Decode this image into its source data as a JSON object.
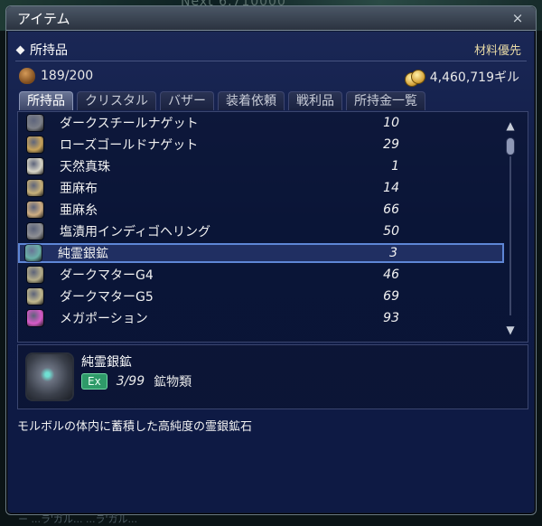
{
  "background": {
    "ghost_text": "Next 6,710000"
  },
  "window": {
    "title": "アイテム",
    "close_icon": "×"
  },
  "header": {
    "section_label": "所持品",
    "sort_label": "材料優先"
  },
  "inventory": {
    "capacity": "189/200",
    "gil": "4,460,719ギル"
  },
  "tabs": [
    {
      "label": "所持品"
    },
    {
      "label": "クリスタル"
    },
    {
      "label": "バザー"
    },
    {
      "label": "装着依頼"
    },
    {
      "label": "戦利品"
    },
    {
      "label": "所持金一覧"
    }
  ],
  "items": [
    {
      "name": "ダークスチールナゲット",
      "qty": "10",
      "icon_color": "#7d8088"
    },
    {
      "name": "ローズゴールドナゲット",
      "qty": "29",
      "icon_color": "#c9a45c"
    },
    {
      "name": "天然真珠",
      "qty": "1",
      "icon_color": "#d9d6c8"
    },
    {
      "name": "亜麻布",
      "qty": "14",
      "icon_color": "#c7b07a"
    },
    {
      "name": "亜麻糸",
      "qty": "66",
      "icon_color": "#cfae83"
    },
    {
      "name": "塩漬用インディゴヘリング",
      "qty": "50",
      "icon_color": "#8e8f94"
    },
    {
      "name": "純霊銀鉱",
      "qty": "3",
      "icon_color": "#6bb0a8",
      "selected": true
    },
    {
      "name": "ダークマターG4",
      "qty": "46",
      "icon_color": "#b6ae8b"
    },
    {
      "name": "ダークマターG5",
      "qty": "69",
      "icon_color": "#c2b98f"
    },
    {
      "name": "メガポーション",
      "qty": "93",
      "icon_color": "#d85bc9"
    }
  ],
  "detail": {
    "name": "純霊銀鉱",
    "ex_label": "Ex",
    "stack": "3/99",
    "category": "鉱物類",
    "description": "モルボルの体内に蓄積した高純度の霊銀鉱石"
  },
  "bottom": {
    "ghost_text": "ー ...ラ'ガル... ...ラ'ガル..."
  }
}
